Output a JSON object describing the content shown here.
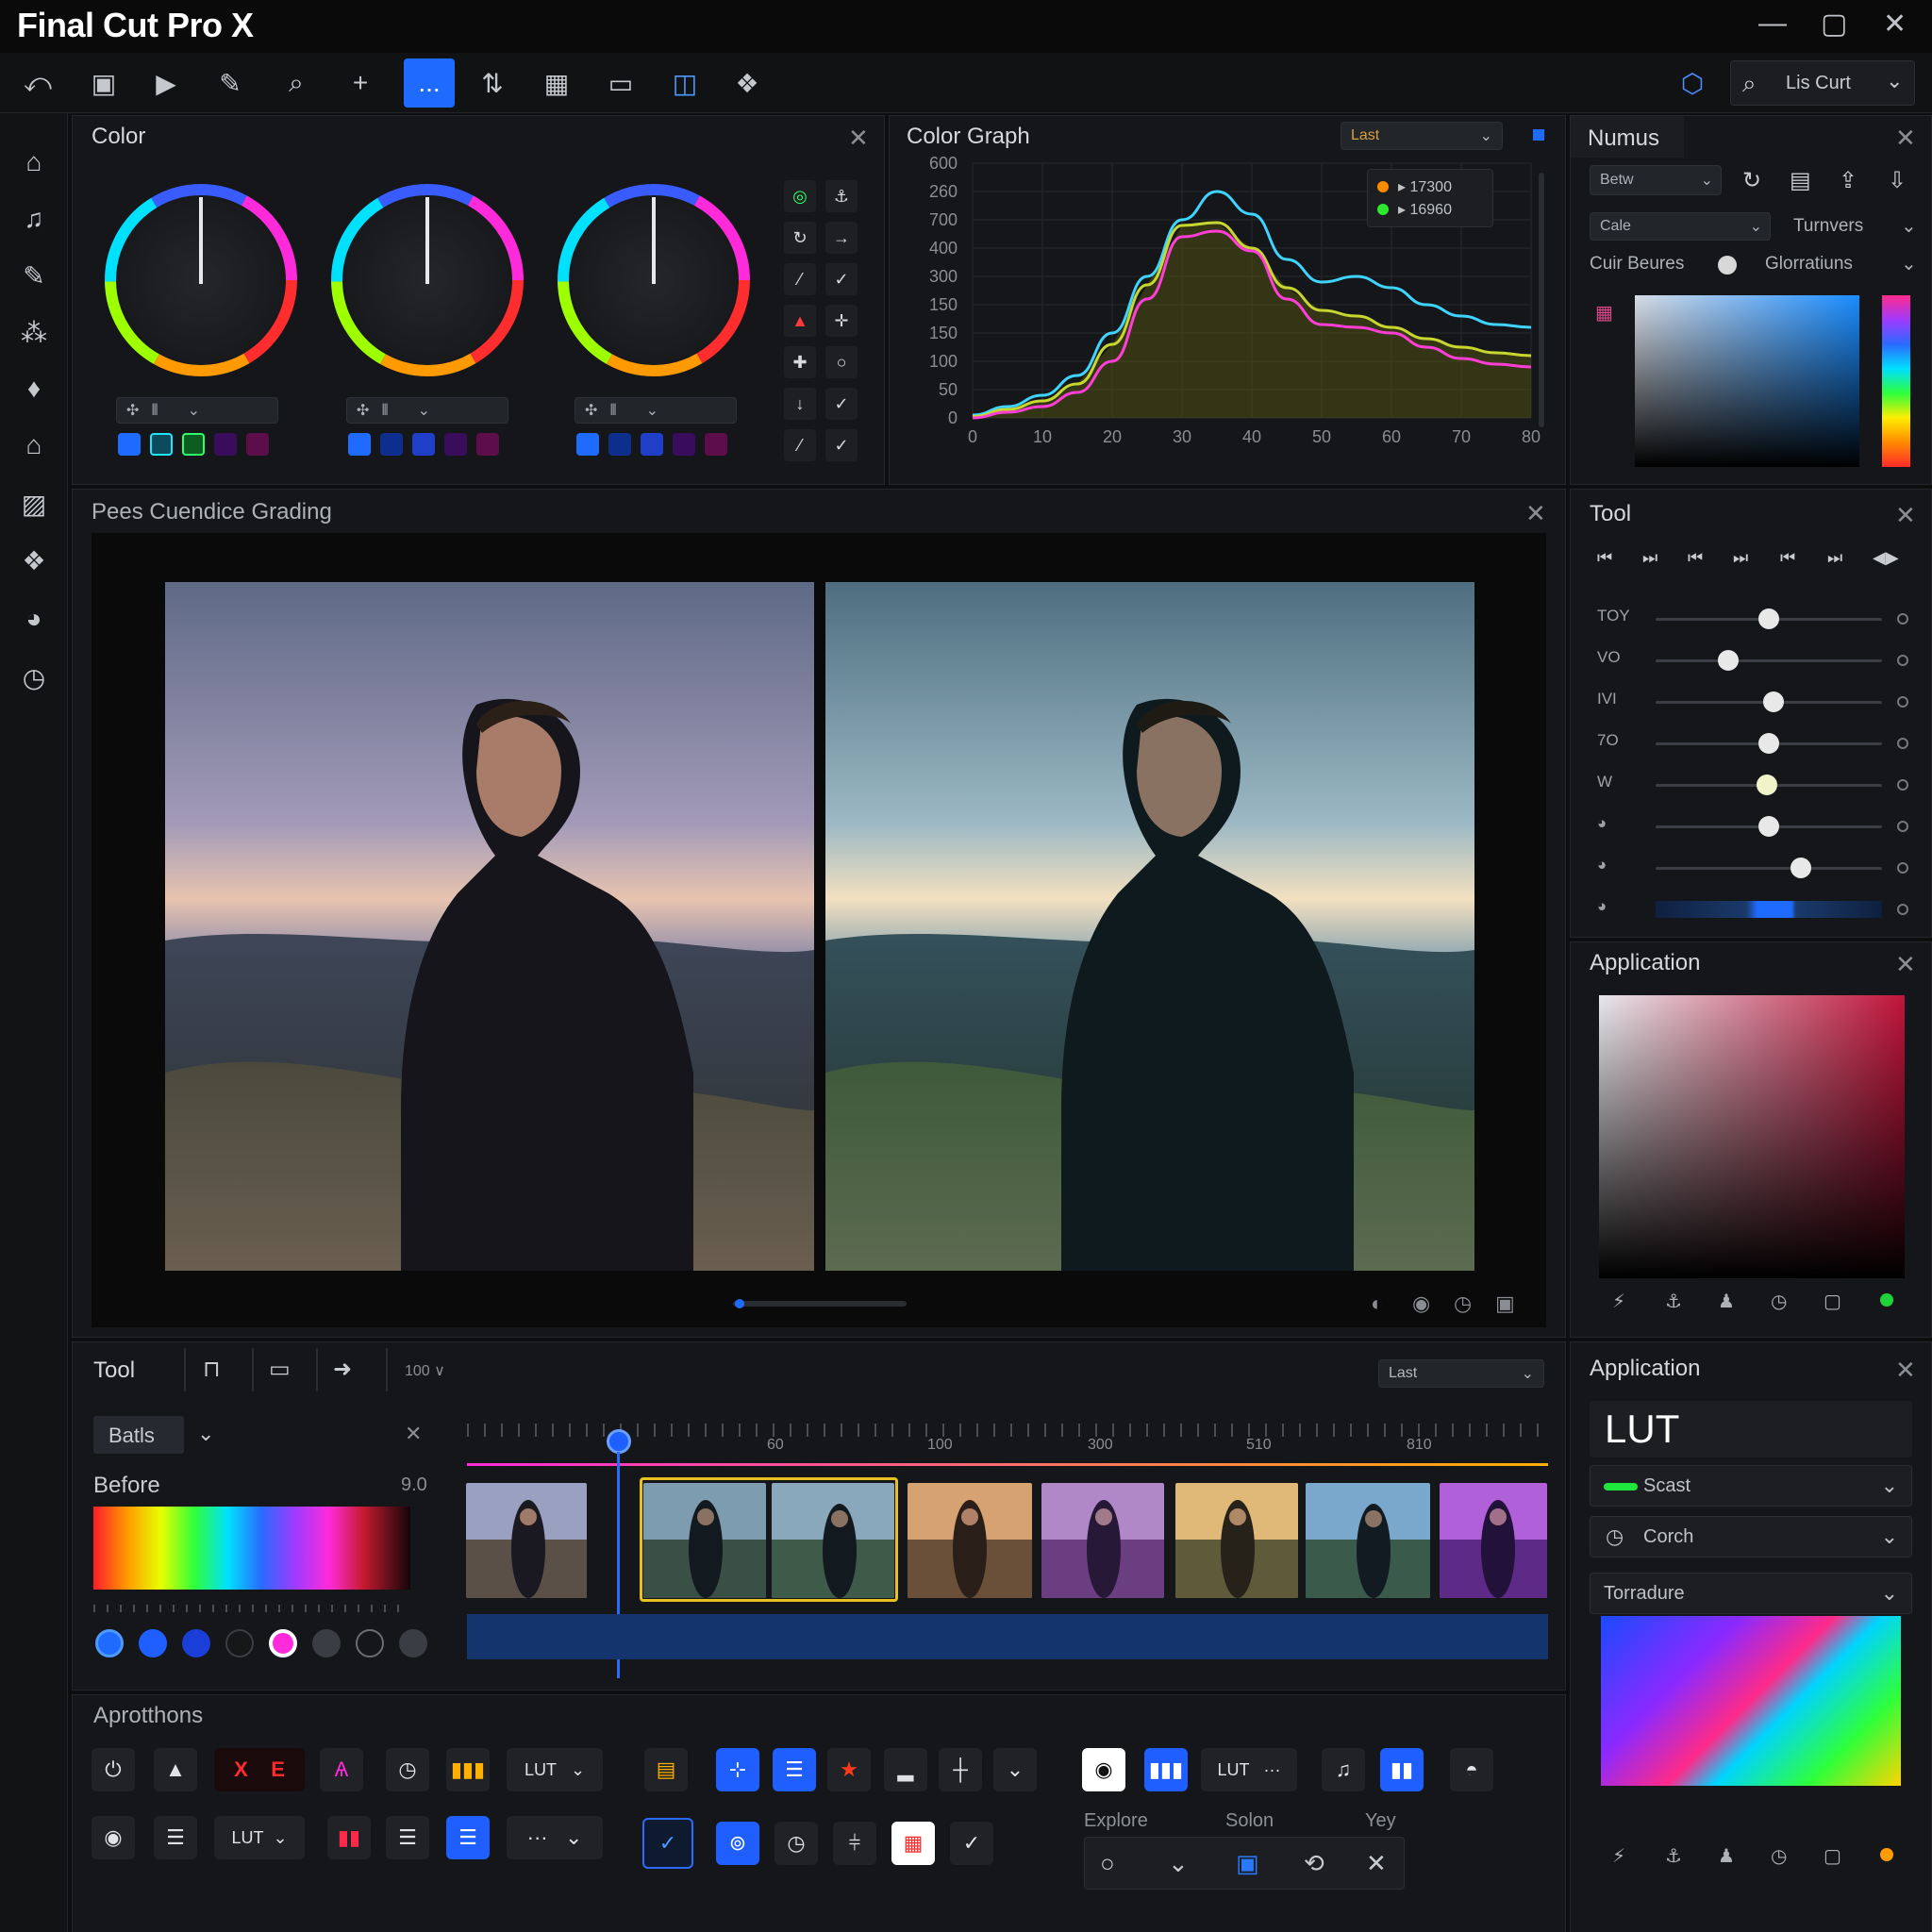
{
  "app": {
    "title": "Final Cut Pro X",
    "minimize": "—",
    "maximize": "▢",
    "close": "✕"
  },
  "toolbar": {
    "icons": [
      "undo-icon",
      "storyboard-icon",
      "play-icon",
      "pen-icon",
      "search-icon",
      "add-icon",
      "more-icon",
      "share-icon",
      "grid-icon",
      "archive-icon",
      "layers-icon",
      "apps-icon"
    ],
    "active_label": "...",
    "search_value": "Lis Curt"
  },
  "sidebar": {
    "icons": [
      "home-icon",
      "music-icon",
      "brush-icon",
      "effects-icon",
      "bell-icon",
      "shape-icon",
      "image-icon",
      "apps-icon",
      "palette-icon",
      "clock-icon"
    ]
  },
  "color_panel": {
    "title": "Color"
  },
  "graph_panel": {
    "title": "Color Graph",
    "dropdown": "Last",
    "legend": [
      {
        "label": "▸ 17300",
        "color": "#ff8a00"
      },
      {
        "label": "▸ 16960",
        "color": "#2ee82e"
      }
    ]
  },
  "chart_data": {
    "type": "line",
    "title": "Color Graph",
    "x": [
      0,
      5,
      10,
      15,
      20,
      25,
      30,
      35,
      40,
      45,
      50,
      55,
      60,
      65,
      70,
      75,
      80
    ],
    "series": [
      {
        "color": "#3fd4ff",
        "values": [
          10,
          40,
          80,
          150,
          300,
          500,
          700,
          800,
          720,
          560,
          480,
          500,
          460,
          400,
          360,
          330,
          320
        ]
      },
      {
        "color": "#c8d630",
        "values": [
          5,
          30,
          60,
          120,
          260,
          470,
          680,
          690,
          600,
          460,
          380,
          360,
          320,
          280,
          250,
          230,
          220
        ]
      },
      {
        "color": "#ff3ed6",
        "values": [
          0,
          20,
          40,
          90,
          200,
          420,
          640,
          660,
          590,
          420,
          330,
          320,
          300,
          250,
          210,
          190,
          180
        ]
      }
    ],
    "ytick_labels": [
      "600",
      "260",
      "700",
      "400",
      "300",
      "150",
      "150",
      "100",
      "50",
      "0"
    ],
    "xtick_labels": [
      "0",
      "10",
      "20",
      "30",
      "40",
      "50",
      "60",
      "70",
      "80"
    ],
    "xlim": [
      0,
      80
    ],
    "ylim": [
      0,
      900
    ],
    "grid": true,
    "legend_position": "top-right"
  },
  "numus_panel": {
    "title": "Numus",
    "dd1": "Betw",
    "dd2": "Cale",
    "dd3": "Turnvers",
    "row_label": "Cuir Beures",
    "row_right": "Glorratiuns"
  },
  "preview": {
    "title": "Pees Cuendice Grading"
  },
  "tool_panel": {
    "title": "Tool",
    "transport": [
      "⏮",
      "⏭",
      "⏮",
      "⏭",
      "⏮",
      "⏭",
      "◀▶"
    ],
    "sliders": [
      {
        "label": "TOY",
        "value": 0.5
      },
      {
        "label": "VO",
        "value": 0.32
      },
      {
        "label": "IVI",
        "value": 0.52
      },
      {
        "label": "7O",
        "value": 0.5
      },
      {
        "label": "W",
        "value": 0.49
      },
      {
        "label": "",
        "value": 0.5
      },
      {
        "label": "",
        "value": 0.64
      },
      {
        "label": "",
        "value": 0.5
      }
    ]
  },
  "app_panel_top": {
    "title": "Application"
  },
  "bottom_tool": {
    "title": "Tool",
    "zoom": "100 ∨",
    "dropdown": "Last",
    "tab": "Batls",
    "before_label": "Before",
    "before_value": "9.0",
    "ruler": [
      "60",
      "100",
      "300",
      "510",
      "810"
    ]
  },
  "applications": {
    "title": "Aprotthons",
    "lut1": "LUT",
    "lut2": "LUT",
    "lut3": "LUT",
    "more": "···",
    "x_btn": "X",
    "e_btn": "E",
    "captions": [
      "Explore",
      "Solon",
      "Yey"
    ]
  },
  "app_panel_bottom": {
    "title": "Application",
    "lut_label": "LUT",
    "dd1": "Scast",
    "dd2": "Corch",
    "dd3": "Torradure"
  }
}
